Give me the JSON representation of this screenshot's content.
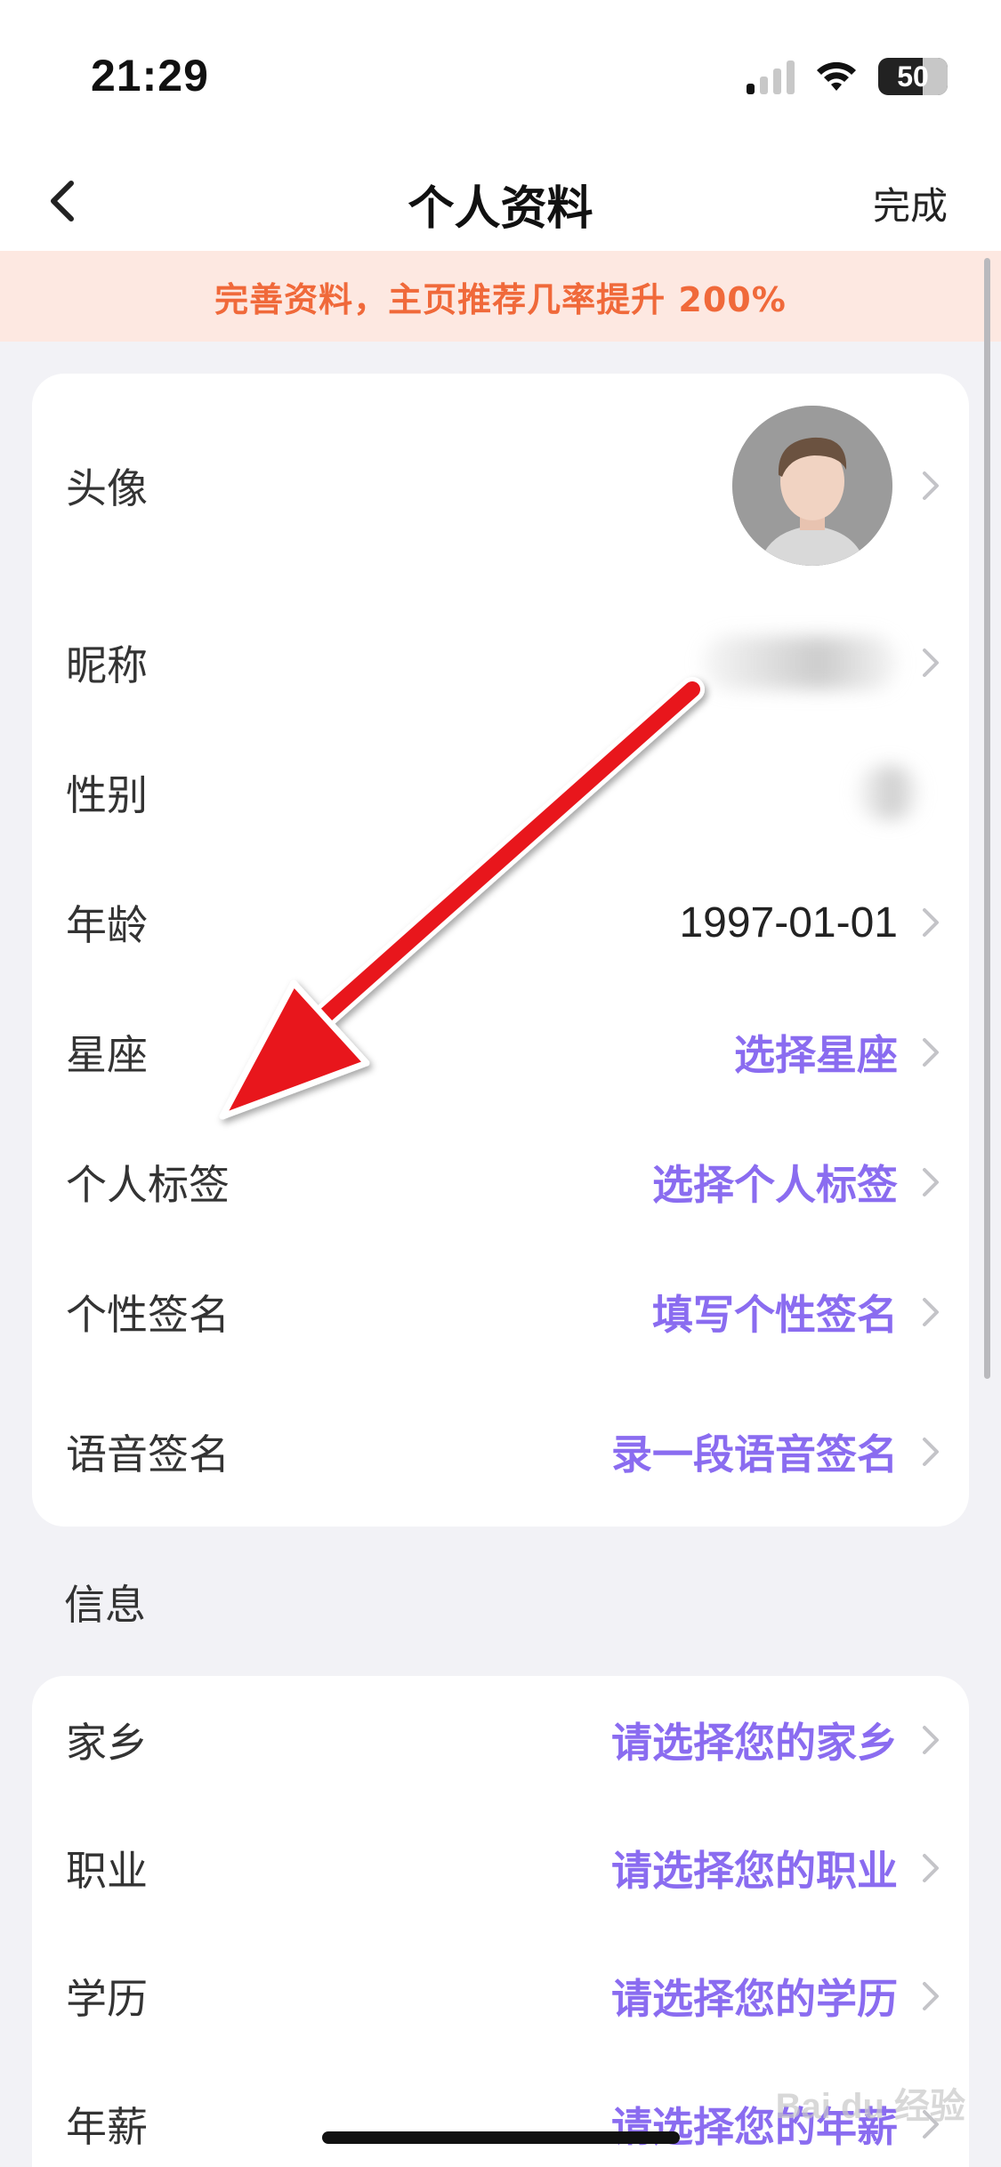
{
  "status_bar": {
    "time": "21:29",
    "battery": "50"
  },
  "nav": {
    "title": "个人资料",
    "done_label": "完成"
  },
  "promo": {
    "text": "完善资料，主页推荐几率提升 200%"
  },
  "basic_card": {
    "rows": [
      {
        "label": "头像",
        "value": ""
      },
      {
        "label": "昵称",
        "value": ""
      },
      {
        "label": "性别",
        "value": ""
      },
      {
        "label": "年龄",
        "value": "1997-01-01"
      },
      {
        "label": "星座",
        "value": "选择星座"
      },
      {
        "label": "个人标签",
        "value": "选择个人标签"
      },
      {
        "label": "个性签名",
        "value": "填写个性签名"
      },
      {
        "label": "语音签名",
        "value": "录一段语音签名"
      }
    ]
  },
  "info_section": {
    "title": "信息",
    "rows": [
      {
        "label": "家乡",
        "value": "请选择您的家乡"
      },
      {
        "label": "职业",
        "value": "请选择您的职业"
      },
      {
        "label": "学历",
        "value": "请选择您的学历"
      },
      {
        "label": "年薪",
        "value": "请选择您的年薪"
      }
    ]
  },
  "watermark": "Bai du 经验",
  "colors": {
    "accent_purple": "#8a6cf0",
    "promo_orange": "#f0693a",
    "promo_bg": "#fde8e1",
    "arrow_red": "#e8141c"
  }
}
